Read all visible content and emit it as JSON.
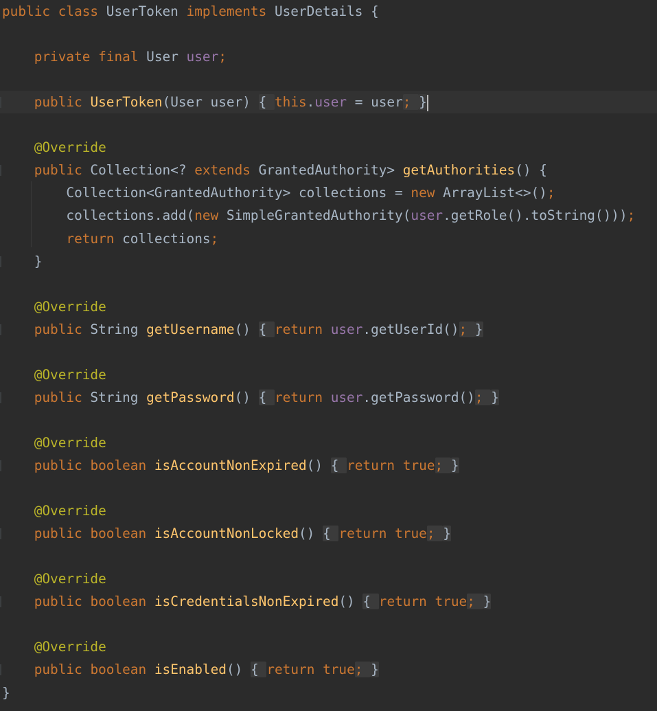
{
  "editor": {
    "language": "Java",
    "colors": {
      "background": "#2b2b2b",
      "keyword": "#cc7832",
      "method": "#ffc66d",
      "field": "#9876aa",
      "annotation": "#bbb529",
      "plain": "#a9b7c6"
    },
    "lines": [
      {
        "tokens": [
          {
            "t": "public",
            "c": "kw"
          },
          {
            "t": " "
          },
          {
            "t": "class",
            "c": "kw"
          },
          {
            "t": " UserToken "
          },
          {
            "t": "implements",
            "c": "kw"
          },
          {
            "t": " UserDetails {"
          }
        ]
      },
      {
        "tokens": []
      },
      {
        "tokens": [
          {
            "t": "    "
          },
          {
            "t": "private",
            "c": "kw"
          },
          {
            "t": " "
          },
          {
            "t": "final",
            "c": "kw"
          },
          {
            "t": " User "
          },
          {
            "t": "user",
            "c": "field"
          },
          {
            "t": ";",
            "c": "semi"
          }
        ]
      },
      {
        "tokens": []
      },
      {
        "current": true,
        "tokens": [
          {
            "t": "    "
          },
          {
            "t": "public",
            "c": "kw"
          },
          {
            "t": " "
          },
          {
            "t": "UserToken",
            "c": "fn"
          },
          {
            "t": "(User user) "
          },
          {
            "t": "{ ",
            "c": "fold"
          },
          {
            "t": "this",
            "c": "kw"
          },
          {
            "t": "."
          },
          {
            "t": "user",
            "c": "field"
          },
          {
            "t": " = user"
          },
          {
            "t": "; ",
            "c": "fold-semi"
          },
          {
            "t": "}",
            "c": "fold"
          },
          {
            "caret": true
          }
        ]
      },
      {
        "tokens": []
      },
      {
        "tokens": [
          {
            "t": "    "
          },
          {
            "t": "@Override",
            "c": "ann"
          }
        ]
      },
      {
        "tokens": [
          {
            "t": "    "
          },
          {
            "t": "public",
            "c": "kw"
          },
          {
            "t": " Collection<? "
          },
          {
            "t": "extends",
            "c": "kw"
          },
          {
            "t": " GrantedAuthority> "
          },
          {
            "t": "getAuthorities",
            "c": "fn"
          },
          {
            "t": "() {"
          }
        ]
      },
      {
        "tokens": [
          {
            "t": "        Collection<GrantedAuthority> collections = "
          },
          {
            "t": "new",
            "c": "kw"
          },
          {
            "t": " ArrayList<>()"
          },
          {
            "t": ";",
            "c": "semi"
          }
        ]
      },
      {
        "tokens": [
          {
            "t": "        collections.add("
          },
          {
            "t": "new",
            "c": "kw"
          },
          {
            "t": " SimpleGrantedAuthority("
          },
          {
            "t": "user",
            "c": "field"
          },
          {
            "t": ".getRole().toString()))"
          },
          {
            "t": ";",
            "c": "semi"
          }
        ]
      },
      {
        "tokens": [
          {
            "t": "        "
          },
          {
            "t": "return",
            "c": "kw"
          },
          {
            "t": " collections"
          },
          {
            "t": ";",
            "c": "semi"
          }
        ]
      },
      {
        "tokens": [
          {
            "t": "    }"
          }
        ]
      },
      {
        "tokens": []
      },
      {
        "tokens": [
          {
            "t": "    "
          },
          {
            "t": "@Override",
            "c": "ann"
          }
        ]
      },
      {
        "tokens": [
          {
            "t": "    "
          },
          {
            "t": "public",
            "c": "kw"
          },
          {
            "t": " String "
          },
          {
            "t": "getUsername",
            "c": "fn"
          },
          {
            "t": "() "
          },
          {
            "t": "{ ",
            "c": "fold"
          },
          {
            "t": "return",
            "c": "kw"
          },
          {
            "t": " "
          },
          {
            "t": "user",
            "c": "field"
          },
          {
            "t": ".getUserId()"
          },
          {
            "t": "; ",
            "c": "fold-semi"
          },
          {
            "t": "}",
            "c": "fold"
          }
        ]
      },
      {
        "tokens": []
      },
      {
        "tokens": [
          {
            "t": "    "
          },
          {
            "t": "@Override",
            "c": "ann"
          }
        ]
      },
      {
        "tokens": [
          {
            "t": "    "
          },
          {
            "t": "public",
            "c": "kw"
          },
          {
            "t": " String "
          },
          {
            "t": "getPassword",
            "c": "fn"
          },
          {
            "t": "() "
          },
          {
            "t": "{ ",
            "c": "fold"
          },
          {
            "t": "return",
            "c": "kw"
          },
          {
            "t": " "
          },
          {
            "t": "user",
            "c": "field"
          },
          {
            "t": ".getPassword()"
          },
          {
            "t": "; ",
            "c": "fold-semi"
          },
          {
            "t": "}",
            "c": "fold"
          }
        ]
      },
      {
        "tokens": []
      },
      {
        "tokens": [
          {
            "t": "    "
          },
          {
            "t": "@Override",
            "c": "ann"
          }
        ]
      },
      {
        "tokens": [
          {
            "t": "    "
          },
          {
            "t": "public",
            "c": "kw"
          },
          {
            "t": " "
          },
          {
            "t": "boolean",
            "c": "kw"
          },
          {
            "t": " "
          },
          {
            "t": "isAccountNonExpired",
            "c": "fn"
          },
          {
            "t": "() "
          },
          {
            "t": "{ ",
            "c": "fold"
          },
          {
            "t": "return",
            "c": "kw"
          },
          {
            "t": " "
          },
          {
            "t": "true",
            "c": "kw"
          },
          {
            "t": "; ",
            "c": "fold-semi"
          },
          {
            "t": "}",
            "c": "fold"
          }
        ]
      },
      {
        "tokens": []
      },
      {
        "tokens": [
          {
            "t": "    "
          },
          {
            "t": "@Override",
            "c": "ann"
          }
        ]
      },
      {
        "tokens": [
          {
            "t": "    "
          },
          {
            "t": "public",
            "c": "kw"
          },
          {
            "t": " "
          },
          {
            "t": "boolean",
            "c": "kw"
          },
          {
            "t": " "
          },
          {
            "t": "isAccountNonLocked",
            "c": "fn"
          },
          {
            "t": "() "
          },
          {
            "t": "{ ",
            "c": "fold"
          },
          {
            "t": "return",
            "c": "kw"
          },
          {
            "t": " "
          },
          {
            "t": "true",
            "c": "kw"
          },
          {
            "t": "; ",
            "c": "fold-semi"
          },
          {
            "t": "}",
            "c": "fold"
          }
        ]
      },
      {
        "tokens": []
      },
      {
        "tokens": [
          {
            "t": "    "
          },
          {
            "t": "@Override",
            "c": "ann"
          }
        ]
      },
      {
        "tokens": [
          {
            "t": "    "
          },
          {
            "t": "public",
            "c": "kw"
          },
          {
            "t": " "
          },
          {
            "t": "boolean",
            "c": "kw"
          },
          {
            "t": " "
          },
          {
            "t": "isCredentialsNonExpired",
            "c": "fn"
          },
          {
            "t": "() "
          },
          {
            "t": "{ ",
            "c": "fold"
          },
          {
            "t": "return",
            "c": "kw"
          },
          {
            "t": " "
          },
          {
            "t": "true",
            "c": "kw"
          },
          {
            "t": "; ",
            "c": "fold-semi"
          },
          {
            "t": "}",
            "c": "fold"
          }
        ]
      },
      {
        "tokens": []
      },
      {
        "tokens": [
          {
            "t": "    "
          },
          {
            "t": "@Override",
            "c": "ann"
          }
        ]
      },
      {
        "tokens": [
          {
            "t": "    "
          },
          {
            "t": "public",
            "c": "kw"
          },
          {
            "t": " "
          },
          {
            "t": "boolean",
            "c": "kw"
          },
          {
            "t": " "
          },
          {
            "t": "isEnabled",
            "c": "fn"
          },
          {
            "t": "() "
          },
          {
            "t": "{ ",
            "c": "fold"
          },
          {
            "t": "return",
            "c": "kw"
          },
          {
            "t": " "
          },
          {
            "t": "true",
            "c": "kw"
          },
          {
            "t": "; ",
            "c": "fold-semi"
          },
          {
            "t": "}",
            "c": "fold"
          }
        ]
      },
      {
        "tokens": [
          {
            "t": "}"
          }
        ]
      }
    ]
  }
}
